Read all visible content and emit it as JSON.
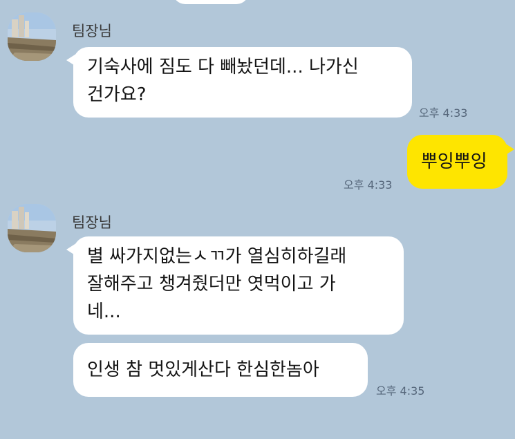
{
  "chat": {
    "messages": [
      {
        "sender": "팀장님",
        "lines": [
          "기숙사에 짐도 다 빼놨던데... 나가신",
          "건가요?"
        ],
        "time": "오후 4:33"
      },
      {
        "sender": "me",
        "lines": [
          "뿌잉뿌잉"
        ],
        "time": "오후 4:33"
      },
      {
        "sender": "팀장님",
        "lines": [
          "별 싸가지없는ㅅㄲ가 열심히하길래",
          "잘해주고 챙겨줬더만 엿먹이고 가",
          "네..."
        ],
        "time": ""
      },
      {
        "sender": "팀장님",
        "lines": [
          "인생 참 멋있게산다 한심한놈아"
        ],
        "time": "오후 4:35"
      }
    ]
  },
  "colors": {
    "background": "#b2c7d9",
    "incoming_bubble": "#ffffff",
    "outgoing_bubble": "#fee500",
    "timestamp": "#55667a"
  },
  "icons": {
    "avatar": "profile-photo-avatar"
  }
}
